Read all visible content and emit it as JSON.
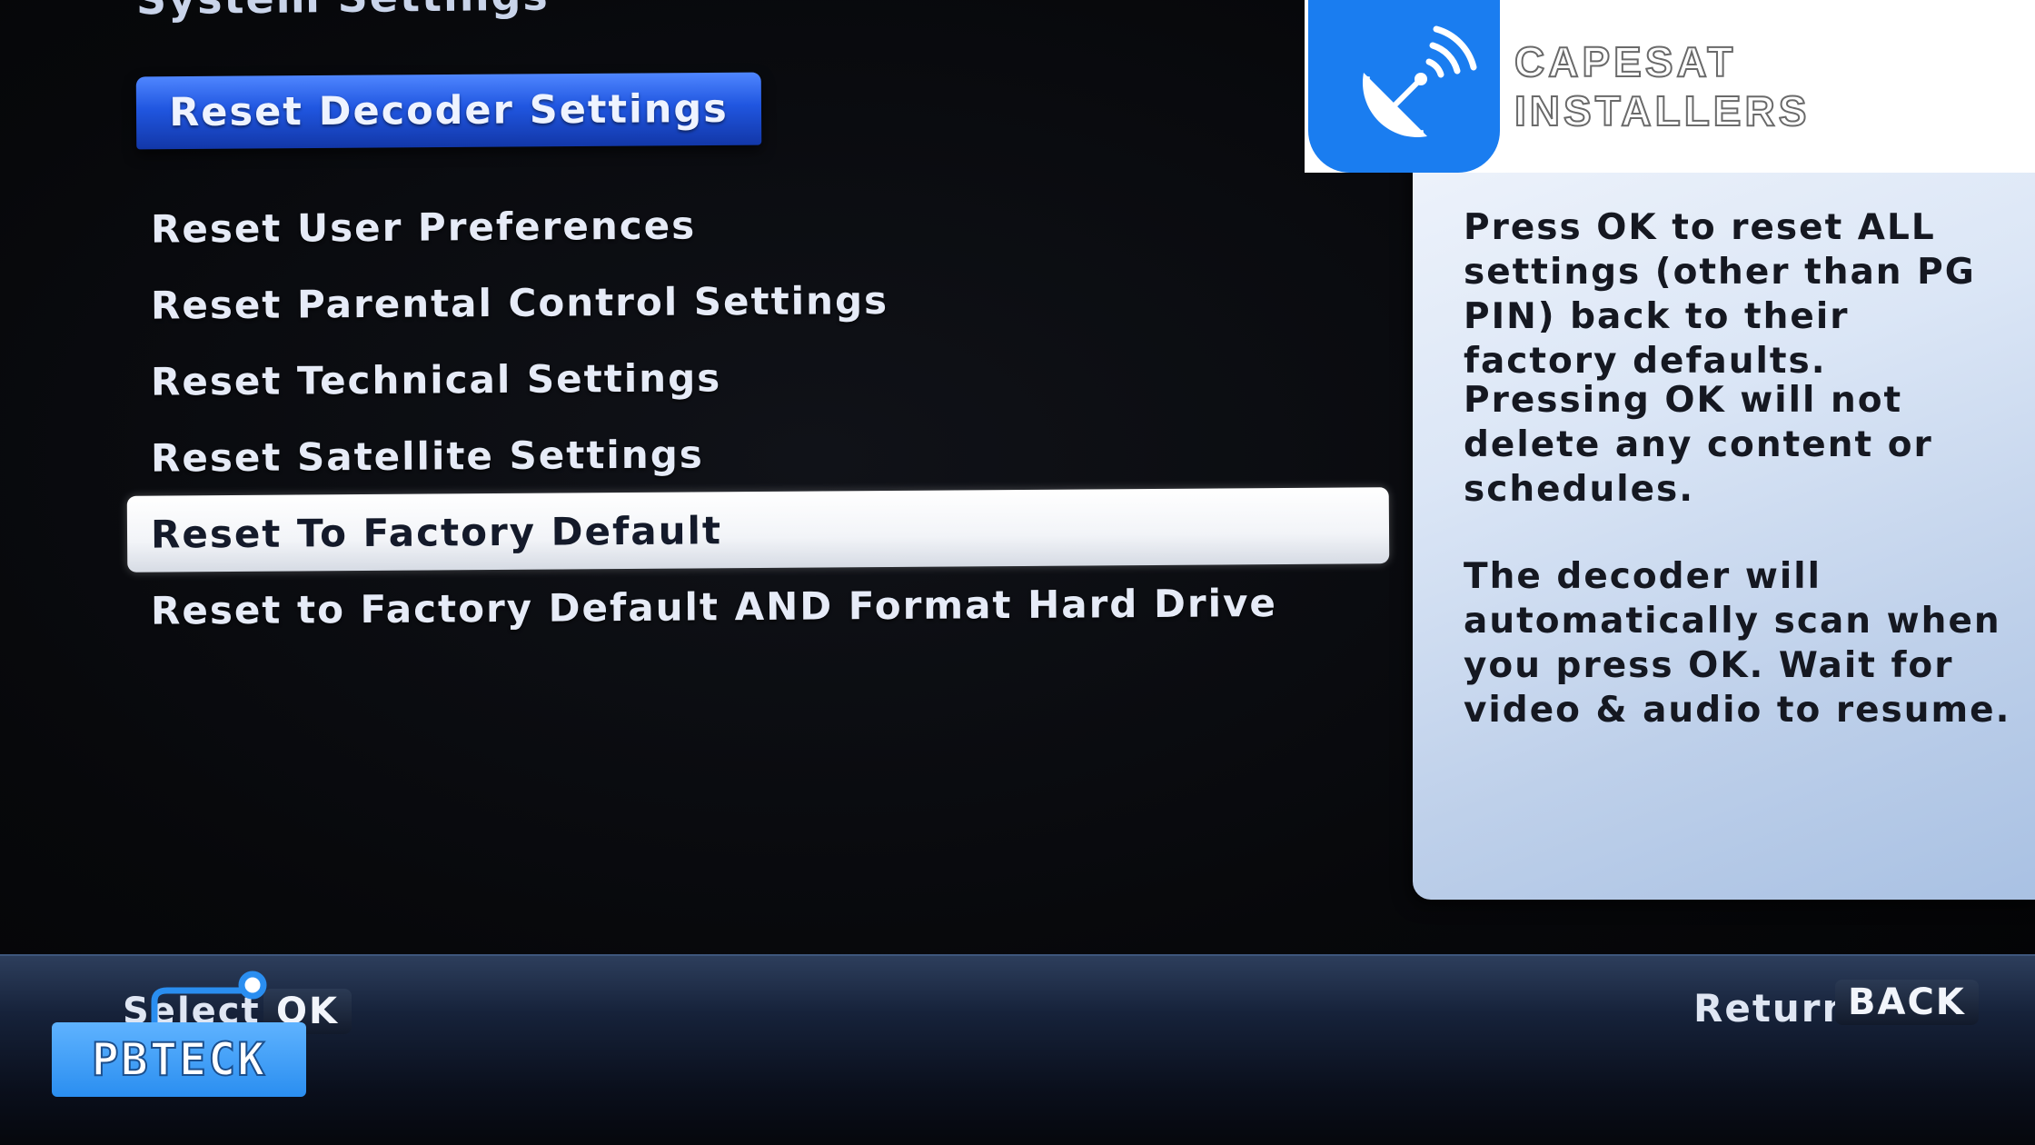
{
  "page_title": "System Settings",
  "section_header": "Reset Decoder Settings",
  "menu": {
    "items": [
      {
        "label": "Reset User Preferences"
      },
      {
        "label": "Reset Parental Control Settings"
      },
      {
        "label": "Reset Technical Settings"
      },
      {
        "label": "Reset Satellite Settings"
      },
      {
        "label": "Reset To Factory Default"
      },
      {
        "label": "Reset to Factory Default AND Format Hard Drive"
      }
    ],
    "selected_label": "Reset To Factory Default"
  },
  "info": {
    "paragraph_1": "Press OK to reset ALL settings (other than PG PIN) back to their factory defaults.",
    "paragraph_2": "Pressing OK will not delete any content or schedules.",
    "paragraph_3": "The decoder will automatically scan when you press OK. Wait for video & audio to resume."
  },
  "logo": {
    "text": "CAPESAT INSTALLERS",
    "icon": "satellite-dish-icon"
  },
  "footer": {
    "select_label": "Select",
    "select_key": "OK",
    "return_label": "Return",
    "return_key": "BACK"
  },
  "watermark": {
    "text": "PBTECK"
  },
  "colors": {
    "header_blue": "#2056e0",
    "selected_bg": "#ffffff",
    "panel_bg": "#dbe6f6",
    "logo_blue": "#1a7df0"
  }
}
